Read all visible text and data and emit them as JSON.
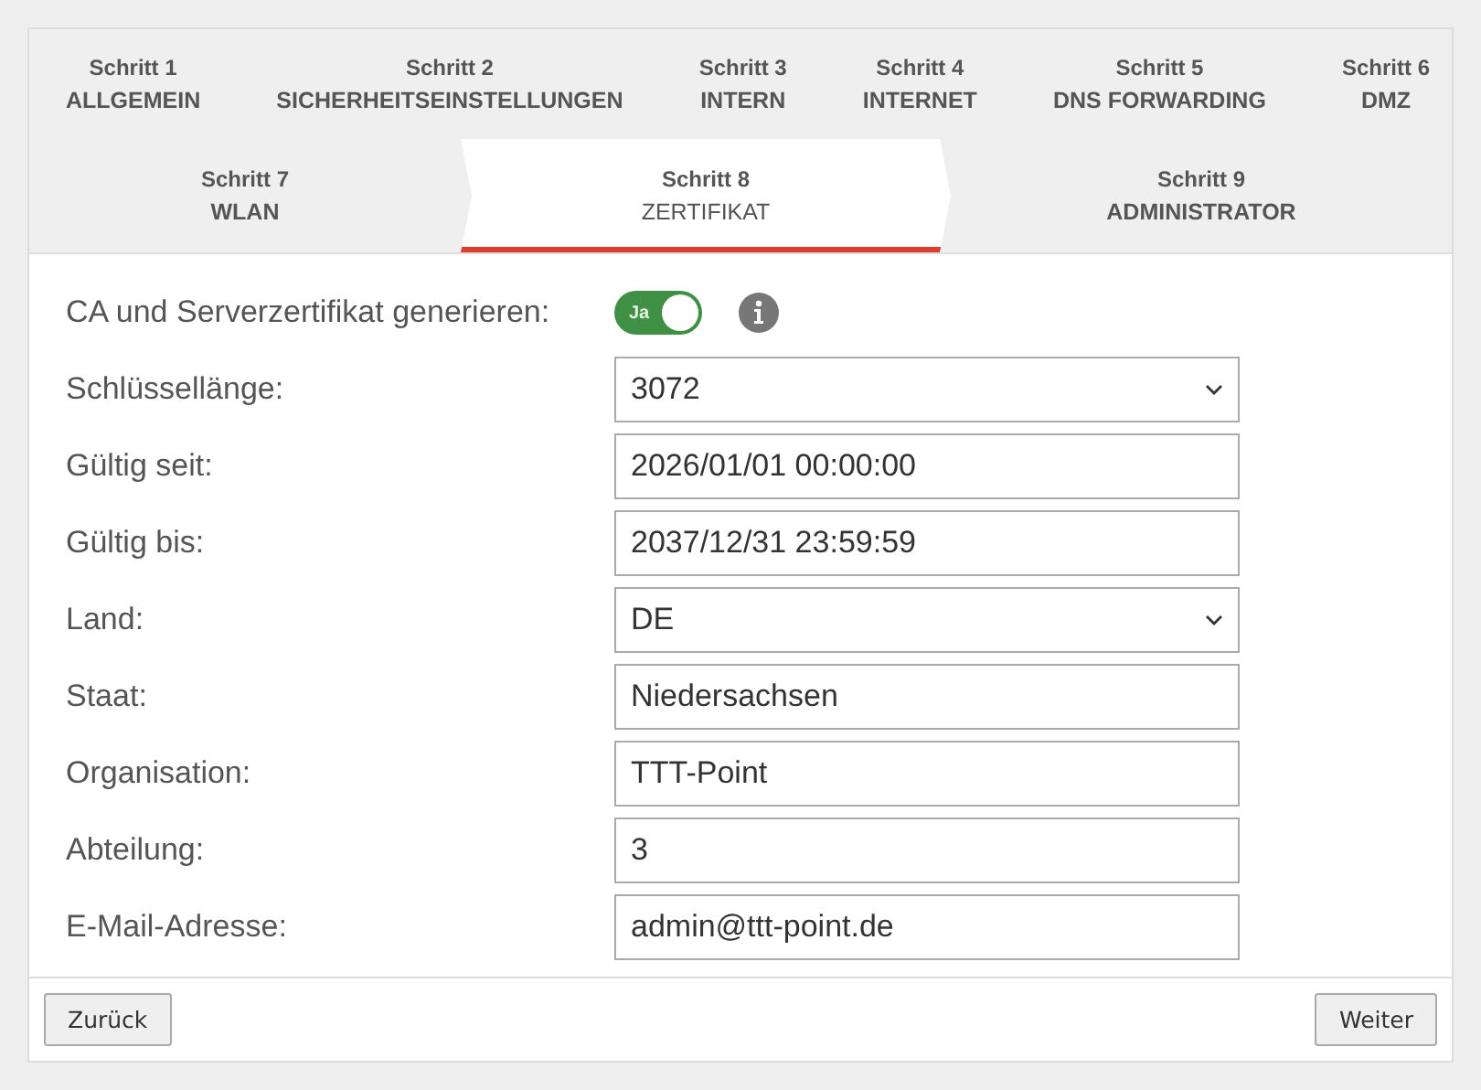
{
  "steps": [
    {
      "number": "Schritt 1",
      "label": "ALLGEMEIN",
      "selected": false
    },
    {
      "number": "Schritt 2",
      "label": "SICHERHEITSEINSTELLUNGEN",
      "selected": false
    },
    {
      "number": "Schritt 3",
      "label": "INTERN",
      "selected": false
    },
    {
      "number": "Schritt 4",
      "label": "INTERNET",
      "selected": false
    },
    {
      "number": "Schritt 5",
      "label": "DNS FORWARDING",
      "selected": false
    },
    {
      "number": "Schritt 6",
      "label": "DMZ",
      "selected": false
    },
    {
      "number": "Schritt 7",
      "label": "WLAN",
      "selected": false
    },
    {
      "number": "Schritt 8",
      "label": "ZERTIFIKAT",
      "selected": true
    },
    {
      "number": "Schritt 9",
      "label": "ADMINISTRATOR",
      "selected": false
    }
  ],
  "fields": [
    {
      "kind": "toggle",
      "label": "CA und Serverzertifikat generieren:",
      "toggle_text": "Ja",
      "on": true
    },
    {
      "kind": "select",
      "label": "Schlüssellänge:",
      "value": "3072"
    },
    {
      "kind": "text",
      "label": "Gültig seit:",
      "value": "2026/01/01 00:00:00"
    },
    {
      "kind": "text",
      "label": "Gültig bis:",
      "value": "2037/12/31 23:59:59"
    },
    {
      "kind": "select",
      "label": "Land:",
      "value": "DE"
    },
    {
      "kind": "text",
      "label": "Staat:",
      "value": "Niedersachsen"
    },
    {
      "kind": "text",
      "label": "Organisation:",
      "value": "TTT-Point"
    },
    {
      "kind": "text",
      "label": "Abteilung:",
      "value": "3"
    },
    {
      "kind": "text",
      "label": "E-Mail-Adresse:",
      "value": "admin@ttt-point.de"
    }
  ],
  "buttons": {
    "back": "Zurück",
    "next": "Weiter"
  }
}
